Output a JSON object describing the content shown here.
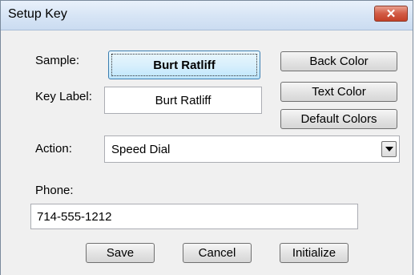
{
  "window": {
    "title": "Setup Key",
    "close_glyph": "✕"
  },
  "sample": {
    "label": "Sample:",
    "button_text": "Burt Ratliff"
  },
  "key_label": {
    "label": "Key Label:",
    "value": "Burt Ratliff"
  },
  "color_buttons": {
    "back_color": "Back Color",
    "text_color": "Text Color",
    "default_colors": "Default Colors"
  },
  "action": {
    "label": "Action:",
    "selected": "Speed Dial"
  },
  "phone": {
    "label": "Phone:",
    "value": "714-555-1212"
  },
  "footer": {
    "save": "Save",
    "cancel": "Cancel",
    "initialize": "Initialize"
  },
  "colors": {
    "title_bar": "#d6e4f5",
    "close_button": "#c44128",
    "sample_button": "#d9f0fc"
  }
}
